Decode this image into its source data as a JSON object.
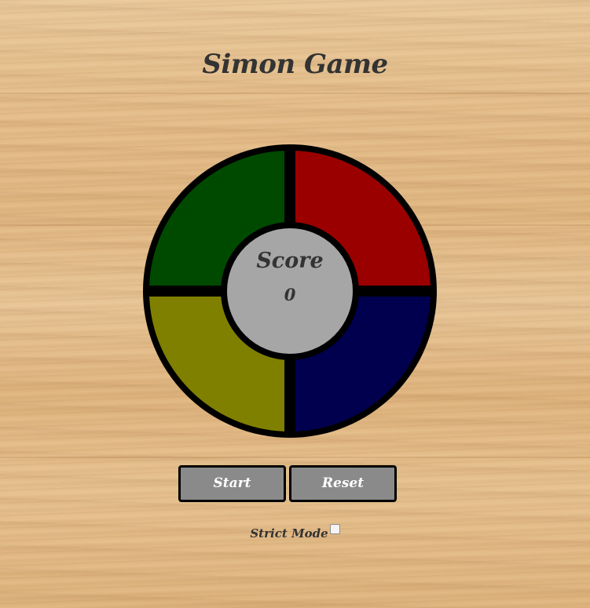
{
  "title": "Simon Game",
  "board": {
    "score_label": "Score",
    "score_value": "0",
    "pads": [
      {
        "name": "green",
        "color": "#004a00"
      },
      {
        "name": "red",
        "color": "#9b0000"
      },
      {
        "name": "yellow",
        "color": "#808000"
      },
      {
        "name": "blue",
        "color": "#00004e"
      }
    ],
    "center_color": "#a6a6a6",
    "outline_color": "#000000"
  },
  "controls": {
    "start_label": "Start",
    "reset_label": "Reset",
    "strict_label": "Strict Mode",
    "strict_checked": false,
    "button_color": "#8a8a8a"
  }
}
